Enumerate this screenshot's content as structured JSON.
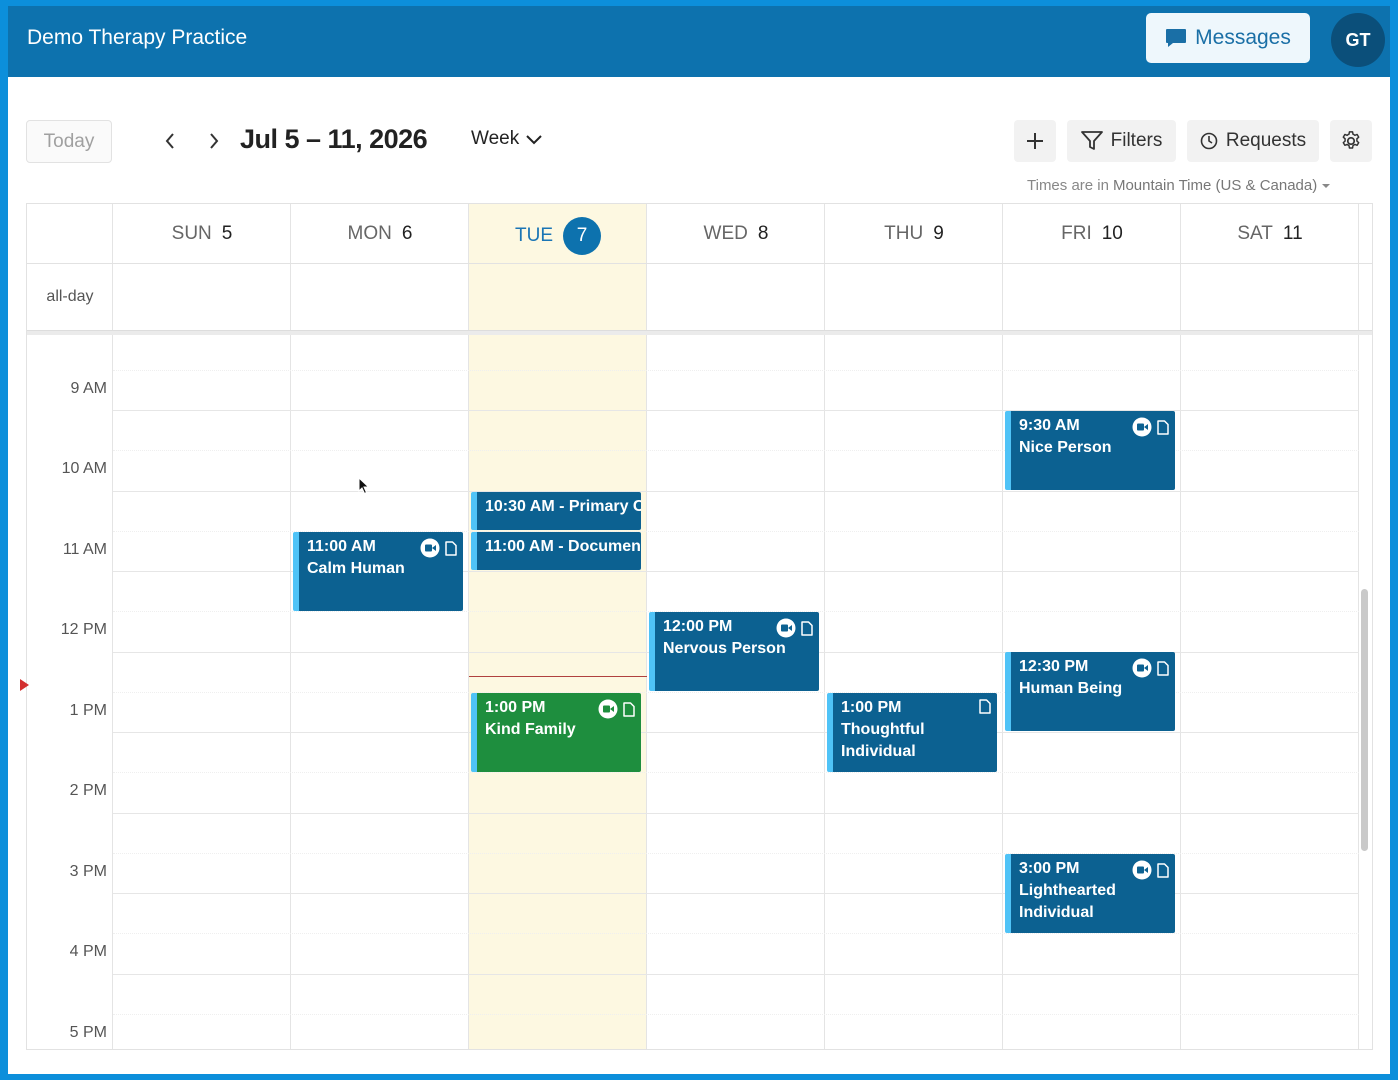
{
  "header": {
    "app_title": "Demo Therapy Practice",
    "messages_label": "Messages",
    "avatar_initials": "GT"
  },
  "toolbar": {
    "today_label": "Today",
    "date_range": "Jul 5 – 11, 2026",
    "view_label": "Week",
    "filters_label": "Filters",
    "requests_label": "Requests",
    "timezone_prefix": "Times are in",
    "timezone_name": "Mountain Time (US & Canada)"
  },
  "calendar": {
    "allday_label": "all-day",
    "days": [
      {
        "dow": "SUN",
        "num": "5"
      },
      {
        "dow": "MON",
        "num": "6"
      },
      {
        "dow": "TUE",
        "num": "7",
        "today": true
      },
      {
        "dow": "WED",
        "num": "8"
      },
      {
        "dow": "THU",
        "num": "9"
      },
      {
        "dow": "FRI",
        "num": "10"
      },
      {
        "dow": "SAT",
        "num": "11"
      }
    ],
    "hours": [
      "9 AM",
      "10 AM",
      "11 AM",
      "12 PM",
      "1 PM",
      "2 PM",
      "3 PM",
      "4 PM",
      "5 PM"
    ],
    "events": [
      {
        "time": "9:30 AM",
        "title": "Nice Person",
        "day": "FRI",
        "video": true,
        "note": true
      },
      {
        "time": "10:30 AM",
        "title": "- Primary Care",
        "day": "TUE",
        "video": false,
        "note": false
      },
      {
        "time": "11:00 AM",
        "title": "- Documentation",
        "day": "TUE",
        "video": false,
        "note": false
      },
      {
        "time": "11:00 AM",
        "title": "Calm Human",
        "day": "MON",
        "video": true,
        "note": true
      },
      {
        "time": "12:00 PM",
        "title": "Nervous Person",
        "day": "WED",
        "video": true,
        "note": true
      },
      {
        "time": "12:30 PM",
        "title": "Human Being",
        "day": "FRI",
        "video": true,
        "note": true
      },
      {
        "time": "1:00 PM",
        "title": "Kind Family",
        "day": "TUE",
        "video": true,
        "note": true,
        "color": "#1e8e3e"
      },
      {
        "time": "1:00 PM",
        "title": "Thoughtful Individual",
        "day": "THU",
        "video": false,
        "note": true
      },
      {
        "time": "3:00 PM",
        "title": "Lighthearted Individual",
        "day": "FRI",
        "video": true,
        "note": true
      }
    ]
  },
  "colors": {
    "brand": "#0d72ae",
    "event_default": "#0c6191",
    "event_accent": "#4fc3f7",
    "today_bg": "#fdf8e1",
    "now_indicator": "#d32f2f"
  }
}
